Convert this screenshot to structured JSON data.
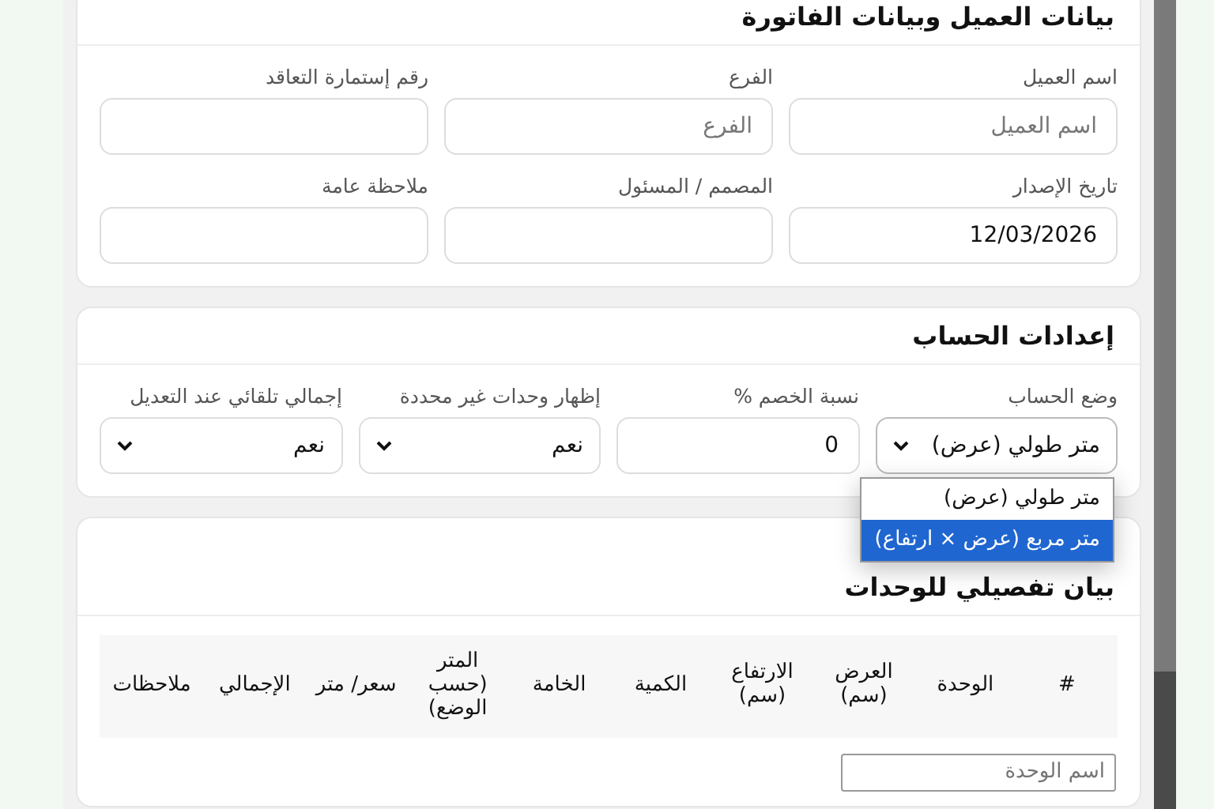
{
  "invoice_card": {
    "title": "بيانات العميل وبيانات الفاتورة",
    "fields": [
      {
        "label": "اسم العميل",
        "placeholder": "اسم العميل"
      },
      {
        "label": "الفرع",
        "placeholder": "الفرع"
      },
      {
        "label": "رقم إستمارة التعاقد"
      },
      {
        "label": "تاريخ الإصدار",
        "value": "12/03/2026"
      },
      {
        "label": "المصمم / المسئول"
      },
      {
        "label": "ملاحظة عامة"
      }
    ]
  },
  "settings_card": {
    "title": "إعدادات الحساب",
    "fields": [
      {
        "kind": "select",
        "label": "وضع الحساب",
        "value": "متر طولي (عرض)",
        "expanded": true,
        "options": [
          {
            "label": "متر طولي (عرض)",
            "highlighted": false
          },
          {
            "label": "متر مربع (عرض × ارتفاع)",
            "highlighted": true
          }
        ]
      },
      {
        "kind": "input",
        "label": "نسبة الخصم %",
        "value": "0"
      },
      {
        "kind": "select",
        "label": "إظهار وحدات غير محددة",
        "value": "نعم",
        "expanded": false
      },
      {
        "kind": "select",
        "label": "إجمالي تلقائي عند التعديل",
        "value": "نعم",
        "expanded": false
      }
    ]
  },
  "units_card": {
    "title": "بيان تفصيلي للوحدات",
    "columns": [
      "#",
      "الوحدة",
      "العرض (سم)",
      "الارتفاع (سم)",
      "الكمية",
      "الخامة",
      "المتر (حسب الوضع)",
      "سعر/ متر",
      "الإجمالي",
      "ملاحظات"
    ],
    "rows": [
      {
        "unit_placeholder": "اسم الوحدة"
      }
    ]
  }
}
